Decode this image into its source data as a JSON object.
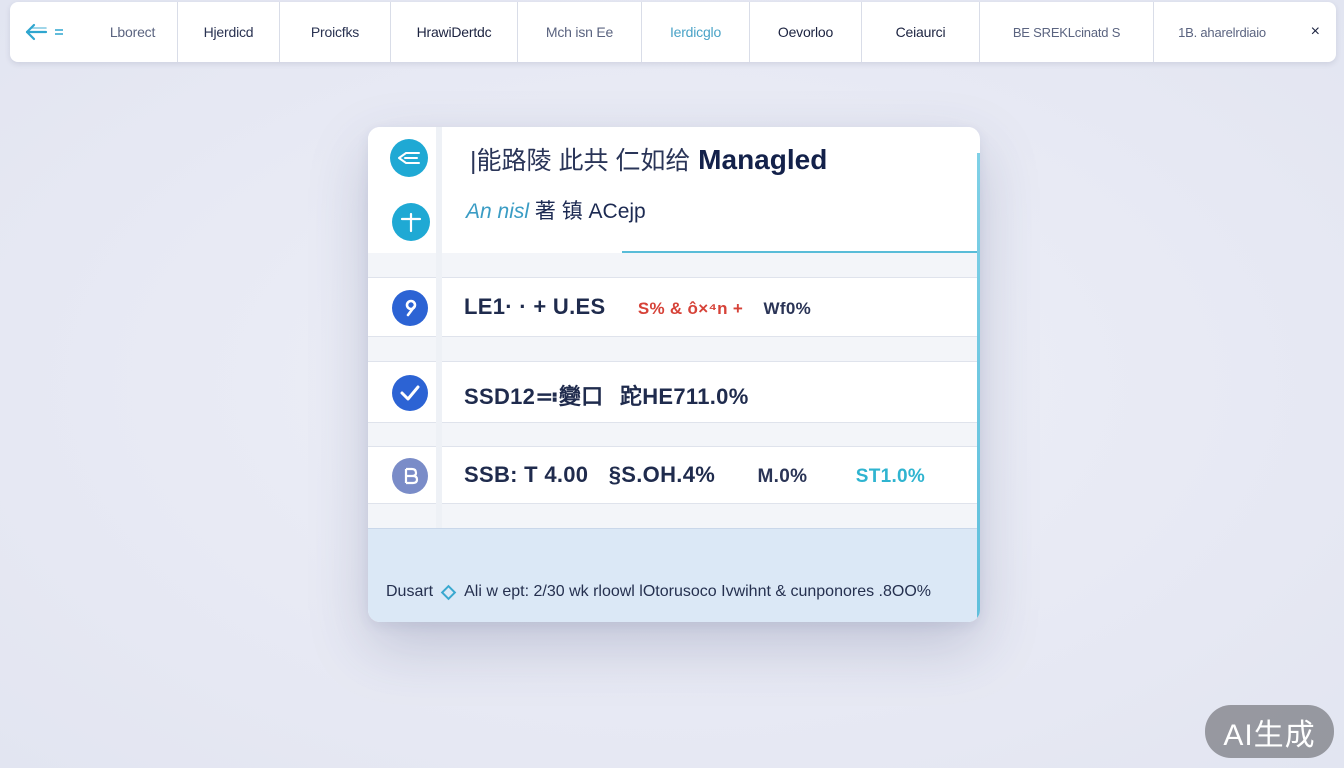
{
  "toolbar": {
    "back_icon": "back-arrow-icon",
    "tabs": [
      {
        "label": "Lborect"
      },
      {
        "label": "Hjerdicd"
      },
      {
        "label": "Proicfks"
      },
      {
        "label": "HrawiDertdc"
      },
      {
        "label": "Mch isn Ee"
      },
      {
        "label": "Ierdicglo"
      },
      {
        "label": "Oevorloo"
      },
      {
        "label": "Ceiaurci"
      },
      {
        "label": "BE SREKLcinatd S"
      },
      {
        "label": "1B. aharelrdiaio"
      }
    ],
    "close_label": "×"
  },
  "card": {
    "title_cjk": "|能路陵 此共 仁如给",
    "title_latin": "Managled",
    "subtitle_tint": "An nisl",
    "subtitle_rest": "著 镇 ACejp",
    "rows": [
      {
        "icon": "info-icon",
        "a": "LE1· · + U.ES",
        "b": "S% & ô×⁴n +",
        "c": "Wf0%"
      },
      {
        "icon": "check-icon",
        "a": "SSD12≕變口",
        "b": "跎HE711.0%"
      },
      {
        "icon": "bitcoin-icon",
        "a": "SSB: T 4.00",
        "b": "§S.OH.4%",
        "c": "M.0%",
        "d": "ST1.0%"
      }
    ],
    "footer": {
      "lead": "Dusart",
      "body": "Ali w ept: 2/30 wk rloowl lOtorusoco Ivwihnt &  cunponores .8OO%"
    }
  },
  "watermark": "AI生成",
  "colors": {
    "accent_cyan": "#2fb4d0",
    "accent_blue": "#2e6fd6",
    "alert_red": "#d64238",
    "navy": "#13214a",
    "footer_bg": "#dbe8f6"
  }
}
